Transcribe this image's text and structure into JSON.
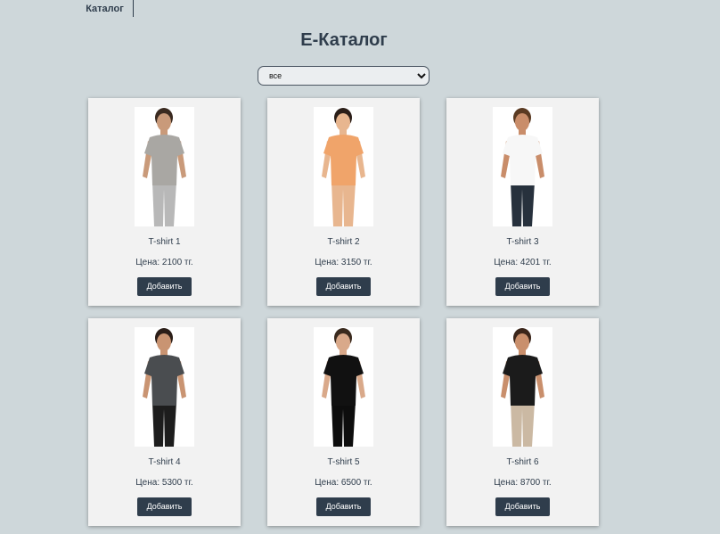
{
  "nav": {
    "catalog_label": "Каталог"
  },
  "header": {
    "title": "E-Каталог"
  },
  "filter": {
    "selected": "все",
    "options": [
      "все"
    ]
  },
  "products": [
    {
      "name": "T-shirt 1",
      "price": "Цена: 2100 тг.",
      "button": "Добавить",
      "shirt_color": "#a9a7a3",
      "skin": "#c99a7a",
      "hair": "#3a2a20",
      "bottom": "#b8b8b8"
    },
    {
      "name": "T-shirt 2",
      "price": "Цена: 3150 тг.",
      "button": "Добавить",
      "shirt_color": "#f0a46a",
      "skin": "#e8b68f",
      "hair": "#2b1e18",
      "bottom": "#e8b68f"
    },
    {
      "name": "T-shirt 3",
      "price": "Цена: 4201 тг.",
      "button": "Добавить",
      "shirt_color": "#f7f7f7",
      "skin": "#c98d6a",
      "hair": "#5a3a22",
      "bottom": "#27313d"
    },
    {
      "name": "T-shirt 4",
      "price": "Цена: 5300 тг.",
      "button": "Добавить",
      "shirt_color": "#4a4d50",
      "skin": "#c99472",
      "hair": "#2b1e18",
      "bottom": "#1d1d1d"
    },
    {
      "name": "T-shirt 5",
      "price": "Цена: 6500 тг.",
      "button": "Добавить",
      "shirt_color": "#111111",
      "skin": "#d9a98a",
      "hair": "#3a2a1e",
      "bottom": "#0d0d0d"
    },
    {
      "name": "T-shirt 6",
      "price": "Цена: 8700 тг.",
      "button": "Добавить",
      "shirt_color": "#1b1b1b",
      "skin": "#c98f6c",
      "hair": "#3a251a",
      "bottom": "#cbb9a3"
    }
  ]
}
